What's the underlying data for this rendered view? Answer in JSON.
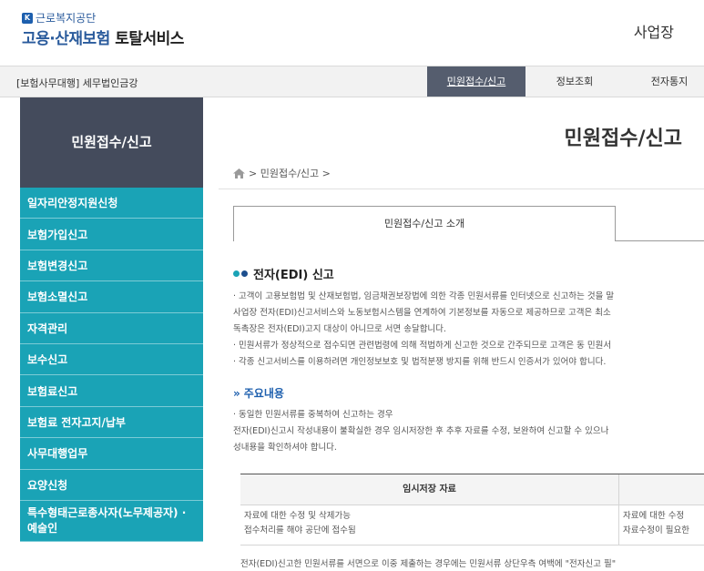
{
  "header": {
    "org_name": "근로복지공단",
    "service_title_blue": "고용·산재보험",
    "service_title_dark": "토탈서비스",
    "workplace_label": "사업장"
  },
  "gnb": {
    "agent_label": "[보험사무대행] 세무법인금강",
    "tabs": [
      {
        "label": "민원접수/신고"
      },
      {
        "label": "정보조회"
      },
      {
        "label": "전자통지"
      }
    ]
  },
  "sidebar": {
    "title": "민원접수/신고",
    "items": [
      {
        "label": "일자리안정지원신청"
      },
      {
        "label": "보험가입신고"
      },
      {
        "label": "보험변경신고"
      },
      {
        "label": "보험소멸신고"
      },
      {
        "label": "자격관리"
      },
      {
        "label": "보수신고"
      },
      {
        "label": "보험료신고"
      },
      {
        "label": "보험료 전자고지/납부"
      },
      {
        "label": "사무대행업무"
      },
      {
        "label": "요양신청"
      },
      {
        "label": "특수형태근로종사자(노무제공자) ·\n예술인"
      }
    ]
  },
  "main": {
    "page_title": "민원접수/신고",
    "breadcrumb": "> 민원접수/신고 >",
    "tab_intro": "민원접수/신고 소개",
    "section_title": "전자(EDI) 신고",
    "paragraphs": [
      "· 고객이 고용보험법 및 산재보험법, 임금채권보장법에 의한 각종 민원서류를 인터넷으로 신고하는 것을 말",
      "사업장 전자(EDI)신고서비스와 노동보험시스템을 연계하여 기본정보를 자동으로 제공하므로 고객은 최소",
      "독촉장은 전자(EDI)고지 대상이 아니므로 서면 송달합니다.",
      "· 민원서류가 정상적으로 접수되면 관련법령에 의해 적법하게 신고한 것으로 간주되므로 고객은 동 민원서",
      "· 각종 신고서비스를 이용하려면 개인정보보호 및 법적분쟁 방지를 위해 반드시 인증서가 있어야 합니다."
    ],
    "sub_title": "주요내용",
    "notes": [
      "· 동일한 민원서류를 중복하여 신고하는 경우",
      "전자(EDI)신고시 작성내용이 불확실한 경우 임시저장한 후 추후 자료를 수정, 보완하여 신고할 수 있으나",
      "성내용을 확인하셔야 합니다."
    ],
    "table": {
      "header_col1": "임시저장 자료",
      "row_col1_line1": "자료에 대한 수정 및 삭제가능",
      "row_col1_line2": "접수처리를 해야 공단에 접수됨",
      "row_col2_line1": "자료에 대한 수정",
      "row_col2_line2": "자료수정이 필요한"
    },
    "bottom_text": "전자(EDI)신고한 민원서류를 서면으로 이중 제출하는 경우에는 민원서류 상단우측 여백에 \"전자신고 필\""
  }
}
